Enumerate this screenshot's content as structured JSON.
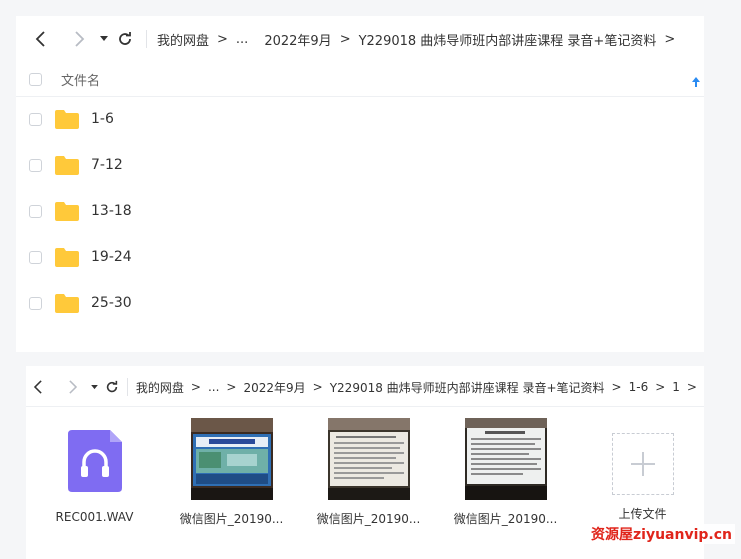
{
  "top_panel": {
    "breadcrumb": [
      "我的网盘",
      "...",
      "2022年9月",
      "Y229018 曲炜导师班内部讲座课程 录音+笔记资料"
    ],
    "header_label": "文件名",
    "folders": [
      "1-6",
      "7-12",
      "13-18",
      "19-24",
      "25-30"
    ]
  },
  "bottom_panel": {
    "breadcrumb": [
      "我的网盘",
      "...",
      "2022年9月",
      "Y229018 曲炜导师班内部讲座课程 录音+笔记资料",
      "1-6",
      "1"
    ],
    "files": [
      {
        "name": "REC001.WAV",
        "icon": "audio-file-icon"
      },
      {
        "name": "微信图片_20190...",
        "icon": "image-thumbnail"
      },
      {
        "name": "微信图片_20190...",
        "icon": "image-thumbnail"
      },
      {
        "name": "微信图片_20190...",
        "icon": "image-thumbnail"
      }
    ],
    "upload_label": "上传文件"
  },
  "watermark": "资源屋ziyuanvip.cn",
  "colors": {
    "folder": "#ffc93a",
    "audio_icon": "#7f6cf2",
    "sort_arrow": "#2a8bf2"
  }
}
